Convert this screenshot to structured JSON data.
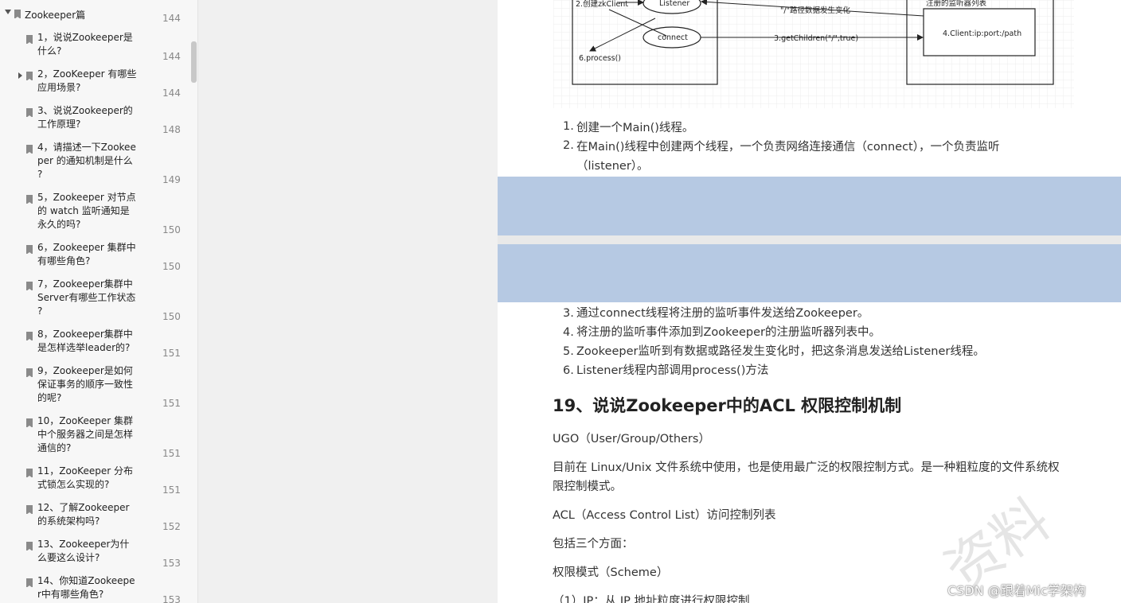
{
  "sidebar": {
    "root": {
      "label": "Zookeeper篇",
      "page": "144"
    },
    "items": [
      {
        "label": "1，说说Zookeeper是\n什么?",
        "page": "144"
      },
      {
        "label": "2，ZooKeeper 有哪些\n应用场景?",
        "page": "144"
      },
      {
        "label": "3、说说Zookeeper的\n工作原理?",
        "page": "148"
      },
      {
        "label": "4，请描述一下Zookee\nper 的通知机制是什么\n?",
        "page": "149"
      },
      {
        "label": "5，Zookeeper 对节点\n的 watch 监听通知是\n永久的吗?",
        "page": "150"
      },
      {
        "label": "6，Zookeeper 集群中\n有哪些角色?",
        "page": "150"
      },
      {
        "label": "7，Zookeeper集群中\nServer有哪些工作状态\n?",
        "page": "150"
      },
      {
        "label": "8，Zookeeper集群中\n是怎样选举leader的?",
        "page": "151"
      },
      {
        "label": "9，Zookeeper是如何\n保证事务的顺序一致性\n的呢?",
        "page": "151"
      },
      {
        "label": "10，ZooKeeper 集群\n中个服务器之间是怎样\n通信的?",
        "page": "151"
      },
      {
        "label": "11，ZooKeeper 分布\n式锁怎么实现的?",
        "page": "151"
      },
      {
        "label": "12、了解Zookeeper\n的系统架构吗?",
        "page": "152"
      },
      {
        "label": "13、Zookeeper为什\n么要这么设计?",
        "page": "153"
      },
      {
        "label": "14、你知道Zookeepe\nr中有哪些角色?",
        "page": "153"
      }
    ]
  },
  "diagram": {
    "create_zkclient": "2.创建zkClient",
    "listener": "Listener",
    "path_change": "\"/\"路径数据发生变化",
    "registry_title": "注册的监听器列表",
    "connect": "connect",
    "get_children": "3.getChildren(\"/\",true)",
    "client_path": "4.Client:ip:port:/path",
    "process": "6.process()"
  },
  "doc": {
    "list1": [
      {
        "num": "1.",
        "text": "创建一个Main()线程。"
      },
      {
        "num": "2.",
        "text": "在Main()线程中创建两个线程，一个负责网络连接通信（connect），一个负责监听"
      }
    ],
    "list1_cont": "（listener）。",
    "list2": [
      {
        "num": "3.",
        "text": "通过connect线程将注册的监听事件发送给Zookeeper。"
      },
      {
        "num": "4.",
        "text": "将注册的监听事件添加到Zookeeper的注册监听器列表中。"
      },
      {
        "num": "5.",
        "text": "Zookeeper监听到有数据或路径发生变化时，把这条消息发送给Listener线程。"
      },
      {
        "num": "6.",
        "text": "Listener线程内部调用process()方法"
      }
    ],
    "heading": "19、说说Zookeeper中的ACL 权限控制机制",
    "p_ugo": "UGO（User/Group/Others）",
    "p_linux_1": "目前在 Linux/Unix 文件系统中使用，也是使用最广泛的权限控制方式。是一种粗粒度的文件系统权",
    "p_linux_2": "限控制模式。",
    "p_acl": "ACL（Access Control List）访问控制列表",
    "p_three": "包括三个方面：",
    "p_scheme": "权限模式（Scheme）",
    "p_ip": "（1）IP：从 IP 地址粒度进行权限控制"
  },
  "watermark": "资料",
  "csdn": "CSDN @跟着Mic学架构"
}
